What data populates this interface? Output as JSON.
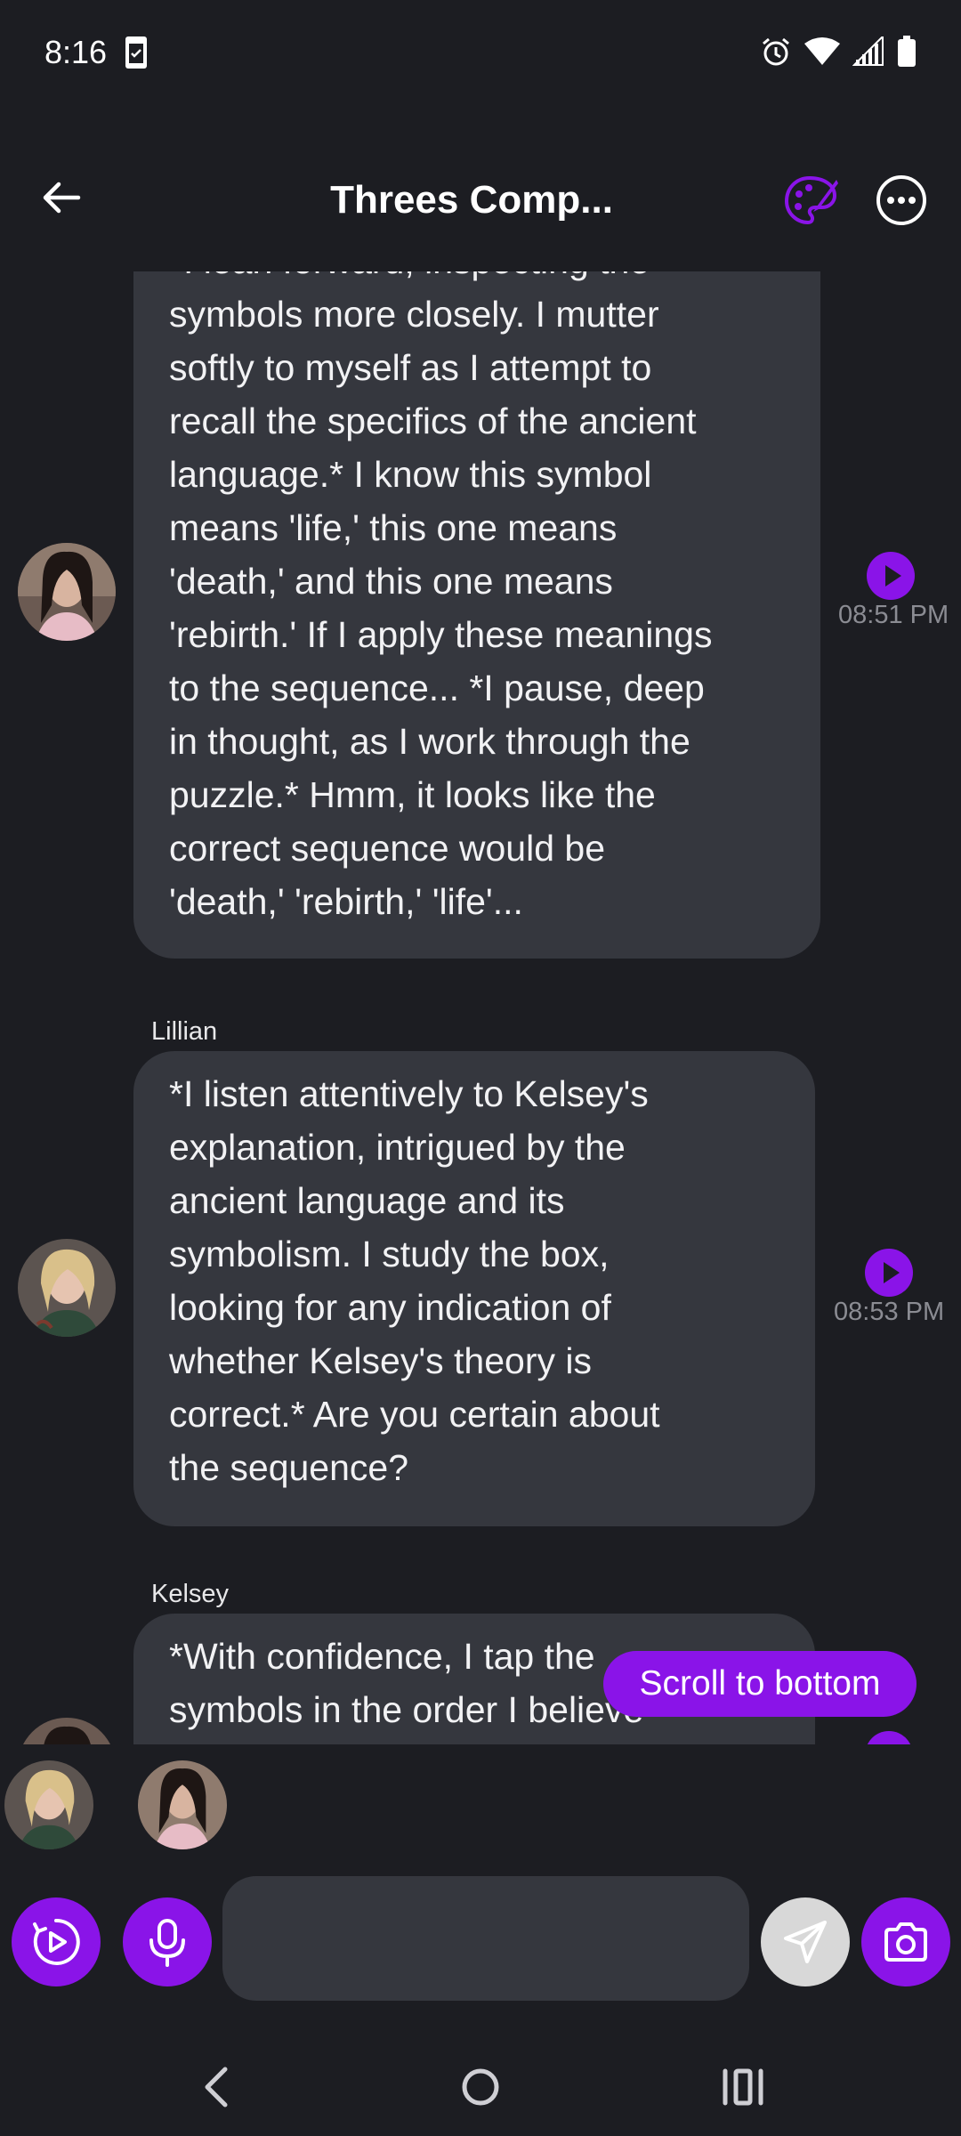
{
  "status_bar": {
    "time": "8:16",
    "icons": [
      "sim-card-icon",
      "alarm-icon",
      "wifi-icon",
      "signal-icon",
      "battery-icon"
    ]
  },
  "header": {
    "title": "Threes Comp..."
  },
  "messages": [
    {
      "sender": "",
      "timestamp": "08:51 PM",
      "lines": [
        "*I lean forward, inspecting the",
        "symbols more closely. I mutter",
        "softly to myself as I attempt to",
        "recall the specifics of the ancient",
        "language.* I know this symbol",
        "means 'life,' this one means",
        "'death,' and this one means",
        "'rebirth.' If I apply these meanings",
        "to the sequence... *I pause, deep",
        "in thought, as I work through the",
        "puzzle.* Hmm, it looks like the",
        "correct sequence would be",
        "'death,' 'rebirth,' 'life'..."
      ]
    },
    {
      "sender": "Lillian",
      "timestamp": "08:53 PM",
      "lines": [
        "*I listen attentively to Kelsey's",
        "explanation, intrigued by the",
        "ancient language and its",
        "symbolism. I study the box,",
        "looking for any indication of",
        "whether Kelsey's theory is",
        "correct.* Are you certain about",
        "the sequence?"
      ]
    },
    {
      "sender": "Kelsey",
      "timestamp": "",
      "lines": [
        "*With confidence, I tap the",
        "symbols in the order I believe"
      ]
    }
  ],
  "scroll_to_bottom_label": "Scroll to bottom",
  "composer": {
    "input_value": "",
    "input_placeholder": ""
  },
  "colors": {
    "background": "#1c1d22",
    "bubble": "#35373e",
    "accent": "#8a14e8",
    "timestamp": "#8b8c93"
  }
}
